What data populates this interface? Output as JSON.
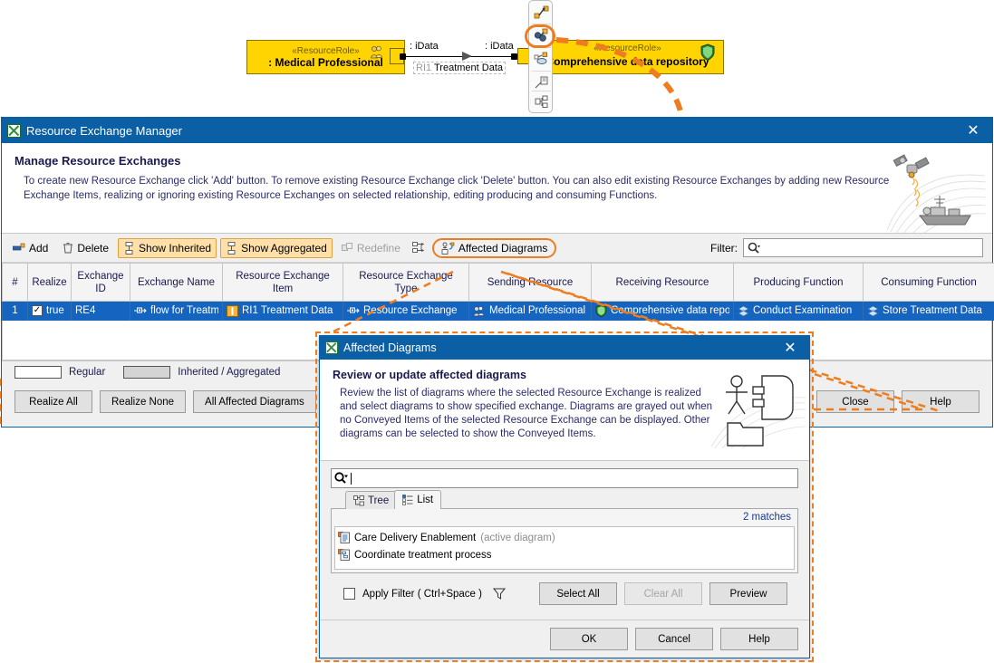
{
  "diagram": {
    "left_node": {
      "stereotype": "«ResourceRole»",
      "name": ": Medical Professional",
      "icon": "resource-role-icon"
    },
    "right_node": {
      "stereotype": "«ResourceRole»",
      "name": "Comprehensive data repository",
      "icon": "shield-icon"
    },
    "left_iface": ": iData",
    "right_iface": ": iData",
    "flow_id": "RI1",
    "flow_name": "Treatment Data",
    "toolbar_icons": [
      "create-relation-icon",
      "resource-exchange-manager-icon",
      "display-related-elements-icon",
      "edit-compartments-icon",
      "select-in-structure-icon"
    ],
    "highlight_color": "#ED7D1F",
    "node_color": "#FFD400"
  },
  "main_window": {
    "title": "Resource Exchange Manager",
    "title_icon": "app-icon",
    "close_label": "✕",
    "banner": {
      "heading": "Manage Resource Exchanges",
      "text": "To create new Resource Exchange click 'Add' button. To remove existing Resource Exchange click 'Delete' button. You can also edit existing Resource Exchanges by adding new Resource Exchange Items, realizing or ignoring existing Resource Exchanges on selected relationship, editing producing and consuming Functions.",
      "art": "satellite-and-ship-illustration"
    },
    "toolbar": {
      "add": "Add",
      "delete": "Delete",
      "show_inherited": "Show Inherited",
      "show_aggregated": "Show Aggregated",
      "redefine": "Redefine",
      "affected_diagrams": "Affected Diagrams",
      "filter_label": "Filter:",
      "filter_value": "",
      "filter_placeholder": ""
    },
    "table": {
      "columns": [
        "#",
        "Realize",
        "Exchange ID",
        "Exchange Name",
        "Resource Exchange Item",
        "Resource Exchange Type",
        "Sending Resource",
        "Receiving Resource",
        "Producing Function",
        "Consuming Function"
      ],
      "rows": [
        {
          "index": "1",
          "realize": "true",
          "realize_checked": true,
          "exchange_id": "RE4",
          "exchange_name": "flow for Treatm",
          "exchange_item": "RI1 Treatment Data",
          "exchange_type": "Resource Exchange",
          "sending_resource": "Medical Professional",
          "receiving_resource": "Comprehensive data repo...",
          "producing_function": "Conduct Examination",
          "consuming_function": "Store Treatment Data"
        }
      ]
    },
    "legend": {
      "regular": "Regular",
      "inherited": "Inherited / Aggregated"
    },
    "buttons": {
      "realize_all": "Realize All",
      "realize_none": "Realize None",
      "all_affected_diagrams": "All Affected Diagrams",
      "close": "Close",
      "help": "Help"
    }
  },
  "affected_dialog": {
    "title": "Affected Diagrams",
    "title_icon": "app-icon",
    "close_label": "✕",
    "banner": {
      "heading": "Review or update affected diagrams",
      "text": "Review the list of diagrams where the selected Resource Exchange is realized and select diagrams to show specified exchange. Diagrams are grayed out when no Conveyed Items of the selected Resource Exchange can be displayed. Other diagrams can be selected to show the Conveyed Items.",
      "art": "actor-and-package-illustration"
    },
    "search": {
      "value": "",
      "placeholder": ""
    },
    "tabs": [
      {
        "label": "Tree",
        "active": false,
        "icon": "tree-icon"
      },
      {
        "label": "List",
        "active": true,
        "icon": "list-icon"
      }
    ],
    "matches": "2 matches",
    "items": [
      {
        "name": "Care Delivery Enablement",
        "suffix": "(active diagram)",
        "icon": "diagram-icon"
      },
      {
        "name": "Coordinate treatment process",
        "suffix": "",
        "icon": "activity-diagram-icon"
      }
    ],
    "apply_filter": "Apply Filter ( Ctrl+Space )",
    "apply_filter_checked": false,
    "buttons": {
      "select_all": "Select All",
      "clear_all": "Clear All",
      "clear_all_disabled": true,
      "preview": "Preview",
      "ok": "OK",
      "cancel": "Cancel",
      "help": "Help"
    }
  }
}
